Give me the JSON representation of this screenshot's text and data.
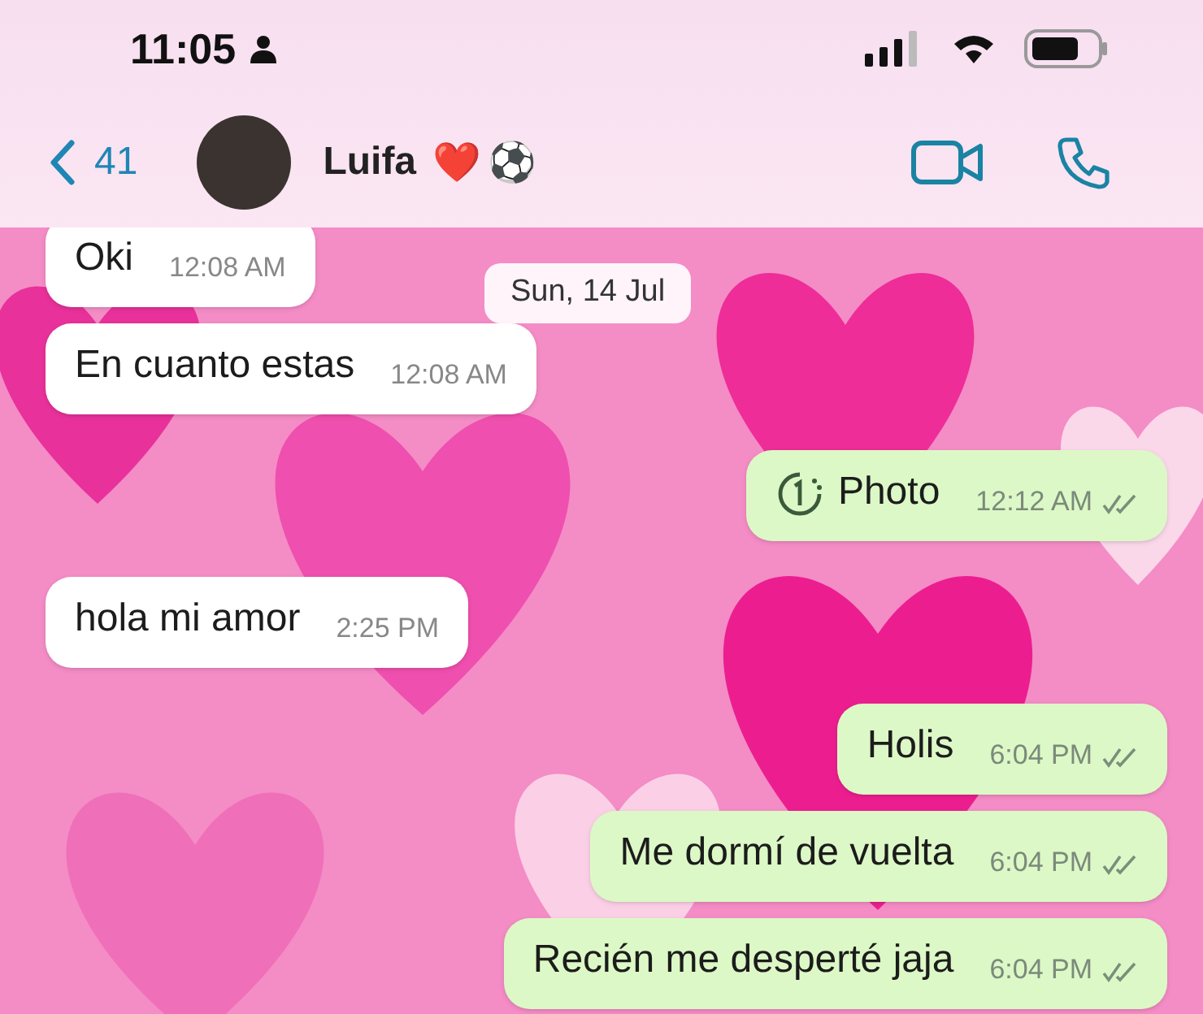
{
  "status_bar": {
    "time": "11:05"
  },
  "header": {
    "back_count": "41",
    "name": "Luifa",
    "emojis": [
      "❤️",
      "⚽"
    ]
  },
  "date_chip": "Sun, 14 Jul",
  "messages": [
    {
      "kind": "incoming",
      "text": "Oki",
      "time": "12:08 AM"
    },
    {
      "kind": "incoming",
      "text": "En cuanto estas",
      "time": "12:08 AM"
    },
    {
      "kind": "view_once",
      "text": "Photo",
      "time": "12:12 AM",
      "read": false
    },
    {
      "kind": "incoming",
      "text": "hola mi amor",
      "time": "2:25 PM"
    },
    {
      "kind": "outgoing",
      "text": "Holis",
      "time": "6:04 PM",
      "read": false
    },
    {
      "kind": "outgoing",
      "text": "Me dormí de vuelta",
      "time": "6:04 PM",
      "read": false
    },
    {
      "kind": "outgoing",
      "text": "Recién me desperté jaja",
      "time": "6:04 PM",
      "read": false
    }
  ]
}
